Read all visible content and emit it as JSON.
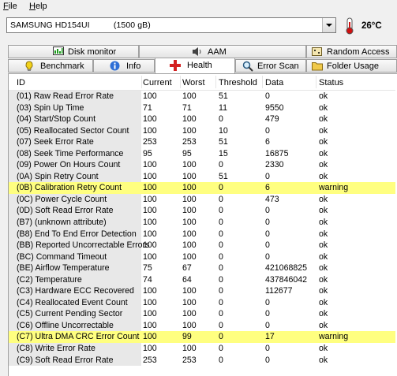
{
  "menu": {
    "file": "File",
    "help": "Help"
  },
  "drive": {
    "name": "SAMSUNG HD154UI          (1500 gB)"
  },
  "temperature": "26°C",
  "tabs_top": [
    {
      "label": "Disk monitor",
      "icon": "disk-monitor-icon"
    },
    {
      "label": "AAM",
      "icon": "speaker-icon"
    },
    {
      "label": "Random Access",
      "icon": "random-access-icon"
    }
  ],
  "tabs_bottom": [
    {
      "label": "Benchmark",
      "icon": "benchmark-icon"
    },
    {
      "label": "Info",
      "icon": "info-icon"
    },
    {
      "label": "Health",
      "icon": "health-cross-icon",
      "active": true
    },
    {
      "label": "Error Scan",
      "icon": "magnifier-icon"
    },
    {
      "label": "Folder Usage",
      "icon": "folder-icon"
    }
  ],
  "columns": [
    "ID",
    "Current",
    "Worst",
    "Threshold",
    "Data",
    "Status"
  ],
  "highlight_color": "#ffff80",
  "rows": [
    {
      "id": "(01) Raw Read Error Rate",
      "current": "100",
      "worst": "100",
      "threshold": "51",
      "data": "0",
      "status": "ok"
    },
    {
      "id": "(03) Spin Up Time",
      "current": "71",
      "worst": "71",
      "threshold": "11",
      "data": "9550",
      "status": "ok"
    },
    {
      "id": "(04) Start/Stop Count",
      "current": "100",
      "worst": "100",
      "threshold": "0",
      "data": "479",
      "status": "ok"
    },
    {
      "id": "(05) Reallocated Sector Count",
      "current": "100",
      "worst": "100",
      "threshold": "10",
      "data": "0",
      "status": "ok"
    },
    {
      "id": "(07) Seek Error Rate",
      "current": "253",
      "worst": "253",
      "threshold": "51",
      "data": "6",
      "status": "ok"
    },
    {
      "id": "(08) Seek Time Performance",
      "current": "95",
      "worst": "95",
      "threshold": "15",
      "data": "16875",
      "status": "ok"
    },
    {
      "id": "(09) Power On Hours Count",
      "current": "100",
      "worst": "100",
      "threshold": "0",
      "data": "2330",
      "status": "ok"
    },
    {
      "id": "(0A) Spin Retry Count",
      "current": "100",
      "worst": "100",
      "threshold": "51",
      "data": "0",
      "status": "ok"
    },
    {
      "id": "(0B) Calibration Retry Count",
      "current": "100",
      "worst": "100",
      "threshold": "0",
      "data": "6",
      "status": "warning"
    },
    {
      "id": "(0C) Power Cycle Count",
      "current": "100",
      "worst": "100",
      "threshold": "0",
      "data": "473",
      "status": "ok"
    },
    {
      "id": "(0D) Soft Read Error Rate",
      "current": "100",
      "worst": "100",
      "threshold": "0",
      "data": "0",
      "status": "ok"
    },
    {
      "id": "(B7) (unknown attribute)",
      "current": "100",
      "worst": "100",
      "threshold": "0",
      "data": "0",
      "status": "ok"
    },
    {
      "id": "(B8) End To End Error Detection",
      "current": "100",
      "worst": "100",
      "threshold": "0",
      "data": "0",
      "status": "ok"
    },
    {
      "id": "(BB) Reported Uncorrectable Errors",
      "current": "100",
      "worst": "100",
      "threshold": "0",
      "data": "0",
      "status": "ok"
    },
    {
      "id": "(BC) Command Timeout",
      "current": "100",
      "worst": "100",
      "threshold": "0",
      "data": "0",
      "status": "ok"
    },
    {
      "id": "(BE) Airflow Temperature",
      "current": "75",
      "worst": "67",
      "threshold": "0",
      "data": "421068825",
      "status": "ok"
    },
    {
      "id": "(C2) Temperature",
      "current": "74",
      "worst": "64",
      "threshold": "0",
      "data": "437846042",
      "status": "ok"
    },
    {
      "id": "(C3) Hardware ECC Recovered",
      "current": "100",
      "worst": "100",
      "threshold": "0",
      "data": "112677",
      "status": "ok"
    },
    {
      "id": "(C4) Reallocated Event Count",
      "current": "100",
      "worst": "100",
      "threshold": "0",
      "data": "0",
      "status": "ok"
    },
    {
      "id": "(C5) Current Pending Sector",
      "current": "100",
      "worst": "100",
      "threshold": "0",
      "data": "0",
      "status": "ok"
    },
    {
      "id": "(C6) Offline Uncorrectable",
      "current": "100",
      "worst": "100",
      "threshold": "0",
      "data": "0",
      "status": "ok"
    },
    {
      "id": "(C7) Ultra DMA CRC Error Count",
      "current": "100",
      "worst": "99",
      "threshold": "0",
      "data": "17",
      "status": "warning"
    },
    {
      "id": "(C8) Write Error Rate",
      "current": "100",
      "worst": "100",
      "threshold": "0",
      "data": "0",
      "status": "ok"
    },
    {
      "id": "(C9) Soft Read Error Rate",
      "current": "253",
      "worst": "253",
      "threshold": "0",
      "data": "0",
      "status": "ok"
    }
  ]
}
